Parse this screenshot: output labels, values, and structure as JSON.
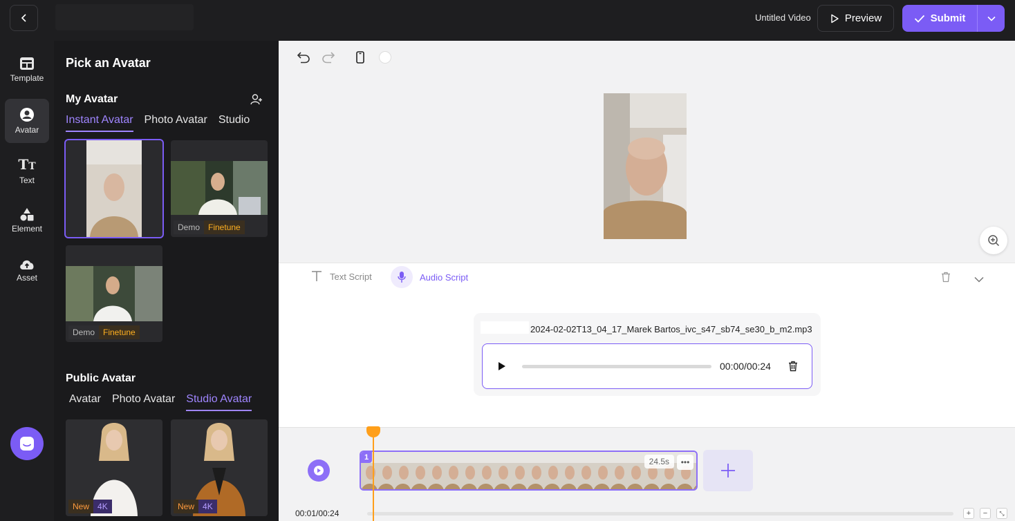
{
  "header": {
    "video_title": "Untitled Video",
    "preview_label": "Preview",
    "submit_label": "Submit"
  },
  "rail": {
    "items": [
      {
        "label": "Template",
        "icon": "template-icon"
      },
      {
        "label": "Avatar",
        "icon": "avatar-icon",
        "active": true
      },
      {
        "label": "Text",
        "icon": "text-icon"
      },
      {
        "label": "Element",
        "icon": "element-icon"
      },
      {
        "label": "Asset",
        "icon": "asset-upload-icon"
      }
    ]
  },
  "panel": {
    "title": "Pick an Avatar",
    "my_avatar": {
      "title": "My Avatar",
      "tabs": [
        "Instant Avatar",
        "Photo Avatar",
        "Studio"
      ],
      "active_tab": "Instant Avatar",
      "cards": [
        {
          "badges": []
        },
        {
          "badges": [
            "Demo",
            "Finetune"
          ]
        },
        {
          "badges": [
            "Demo",
            "Finetune"
          ]
        }
      ]
    },
    "public_avatar": {
      "title": "Public Avatar",
      "tabs": [
        "Avatar",
        "Photo Avatar",
        "Studio Avatar"
      ],
      "active_tab": "Studio Avatar",
      "cards": [
        {
          "badges": [
            "New",
            "4K"
          ]
        },
        {
          "badges": [
            "New",
            "4K"
          ]
        }
      ]
    }
  },
  "script": {
    "text_script_label": "Text Script",
    "audio_script_label": "Audio Script",
    "file_name": "2024-02-02T13_04_17_Marek Bartos_ivc_s47_sb74_se30_b_m2.mp3",
    "player_time": "00:00/00:24"
  },
  "timeline": {
    "clip_index": "1",
    "clip_duration": "24.5s",
    "current_time": "00:01/00:24"
  },
  "colors": {
    "accent": "#7b5cf5",
    "playhead": "#ff9f1a"
  }
}
